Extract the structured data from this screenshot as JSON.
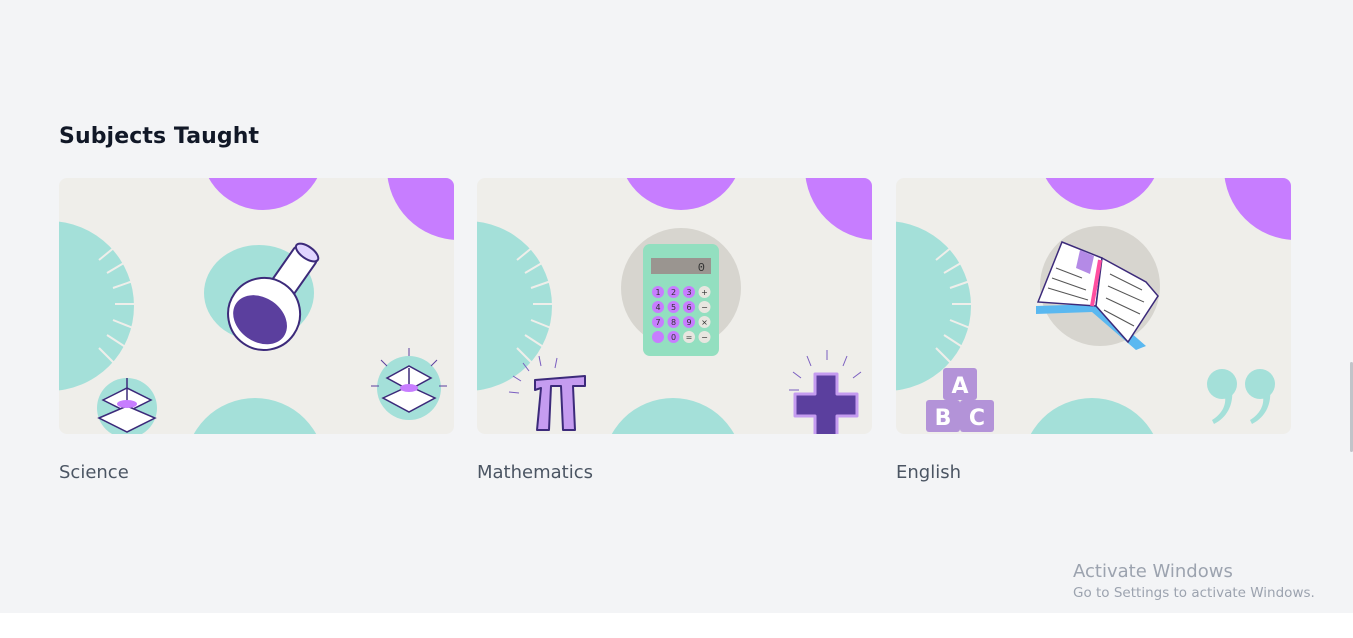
{
  "section": {
    "title": "Subjects Taught"
  },
  "subjects": [
    {
      "label": "Science",
      "icon": "flask-icon"
    },
    {
      "label": "Mathematics",
      "icon": "calculator-icon"
    },
    {
      "label": "English",
      "icon": "open-book-icon"
    }
  ],
  "math_card": {
    "calculator_display": "0",
    "calculator_keys": [
      "1",
      "2",
      "3",
      "+",
      "4",
      "5",
      "6",
      "−",
      "7",
      "8",
      "9",
      "×",
      "",
      "0",
      "=",
      "−"
    ]
  },
  "english_card": {
    "blocks": [
      "A",
      "B",
      "C"
    ]
  },
  "watermark": {
    "title": "Activate Windows",
    "subtitle": "Go to Settings to activate Windows."
  },
  "colors": {
    "purple": "#c77dff",
    "teal": "#a4e0d9",
    "card_bg": "#efeeea",
    "dark_purple": "#5b3f9e",
    "page_bg": "#f3f4f6"
  }
}
